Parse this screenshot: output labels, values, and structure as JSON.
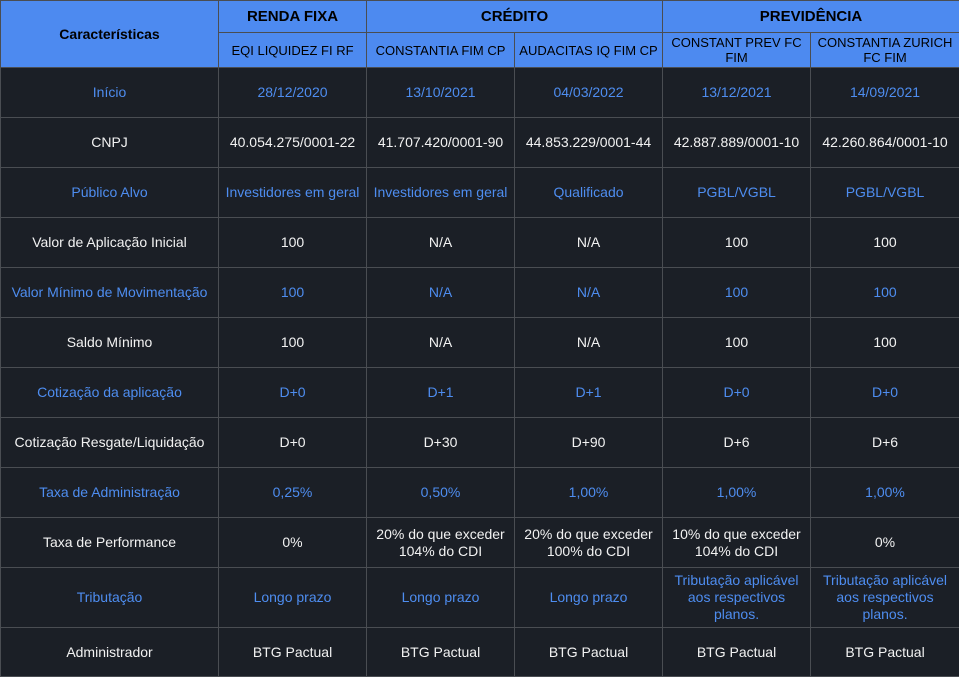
{
  "header": {
    "corner_label": "Características",
    "groups": [
      "RENDA FIXA",
      "CRÉDITO",
      "PREVIDÊNCIA"
    ],
    "funds": [
      "EQI LIQUIDEZ FI RF",
      "CONSTANTIA FIM CP",
      "AUDACITAS IQ FIM CP",
      "CONSTANT PREV FC FIM",
      "CONSTANTIA ZURICH FC FIM"
    ]
  },
  "rows": [
    {
      "label": "Início",
      "values": [
        "28/12/2020",
        "13/10/2021",
        "04/03/2022",
        "13/12/2021",
        "14/09/2021"
      ]
    },
    {
      "label": "CNPJ",
      "values": [
        "40.054.275/0001-22",
        "41.707.420/0001-90",
        "44.853.229/0001-44",
        "42.887.889/0001-10",
        "42.260.864/0001-10"
      ]
    },
    {
      "label": "Público Alvo",
      "values": [
        "Investidores em geral",
        "Investidores em geral",
        "Qualificado",
        "PGBL/VGBL",
        "PGBL/VGBL"
      ]
    },
    {
      "label": "Valor de Aplicação Inicial",
      "values": [
        "100",
        "N/A",
        "N/A",
        "100",
        "100"
      ]
    },
    {
      "label": "Valor Mínimo de Movimentação",
      "values": [
        "100",
        "N/A",
        "N/A",
        "100",
        "100"
      ]
    },
    {
      "label": "Saldo Mínimo",
      "values": [
        "100",
        "N/A",
        "N/A",
        "100",
        "100"
      ]
    },
    {
      "label": "Cotização da aplicação",
      "values": [
        "D+0",
        "D+1",
        "D+1",
        "D+0",
        "D+0"
      ]
    },
    {
      "label": "Cotização Resgate/Liquidação",
      "values": [
        "D+0",
        "D+30",
        "D+90",
        "D+6",
        "D+6"
      ]
    },
    {
      "label": "Taxa de Administração",
      "values": [
        "0,25%",
        "0,50%",
        "1,00%",
        "1,00%",
        "1,00%"
      ]
    },
    {
      "label": "Taxa de Performance",
      "values": [
        "0%",
        "20% do que exceder 104% do CDI",
        "20% do que exceder 100% do CDI",
        "10% do que exceder 104% do CDI",
        "0%"
      ]
    },
    {
      "label": "Tributação",
      "values": [
        "Longo prazo",
        "Longo prazo",
        "Longo prazo",
        "Tributação aplicável aos respectivos planos.",
        "Tributação aplicável aos respectivos planos."
      ]
    },
    {
      "label": "Administrador",
      "values": [
        "BTG Pactual",
        "BTG Pactual",
        "BTG Pactual",
        "BTG Pactual",
        "BTG Pactual"
      ]
    }
  ],
  "colors": {
    "header_bg": "#4d8af0",
    "body_bg": "#1b1f26",
    "accent_text": "#4e8df0",
    "plain_text": "#f2f2f2",
    "border": "#4a4d52"
  }
}
